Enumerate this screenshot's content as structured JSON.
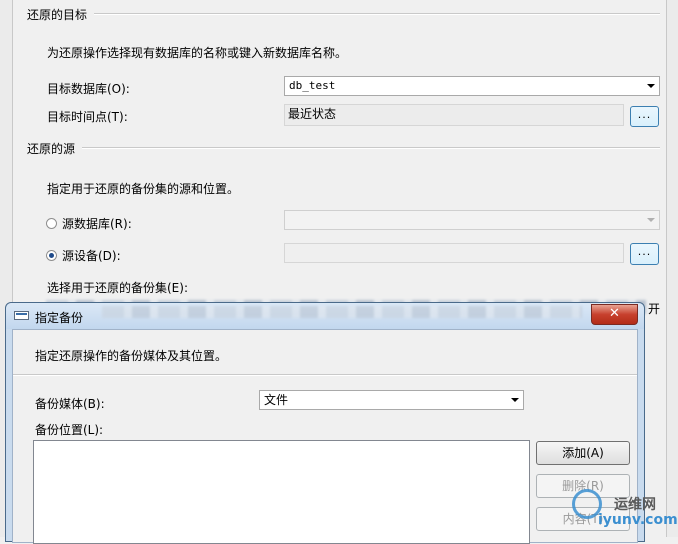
{
  "restore_target": {
    "section_title": "还原的目标",
    "description": "为还原操作选择现有数据库的名称或键入新数据库名称。",
    "target_db_label": "目标数据库(O):",
    "target_db_value": "db_test",
    "target_time_label": "目标时间点(T):",
    "target_time_value": "最近状态",
    "browse_label": "..."
  },
  "restore_source": {
    "section_title": "还原的源",
    "description": "指定用于还原的备份集的源和位置。",
    "source_db_label": "源数据库(R):",
    "source_device_label": "源设备(D):",
    "browse_label": "...",
    "backup_set_label": "选择用于还原的备份集(E):",
    "partial_text": "开"
  },
  "dialog": {
    "title": "指定备份",
    "close_label": "✕",
    "description": "指定还原操作的备份媒体及其位置。",
    "media_label": "备份媒体(B):",
    "media_value": "文件",
    "location_label": "备份位置(L):",
    "add_label": "添加(A)",
    "remove_label": "删除(R)",
    "contents_label": "内容(T)"
  },
  "watermark": {
    "line1": "运维网",
    "line2": "iyunv.com"
  }
}
